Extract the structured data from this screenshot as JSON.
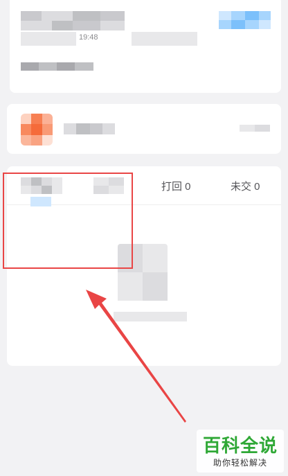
{
  "assignment_card": {
    "time_partial": "19:48"
  },
  "tabs": {
    "returned_label": "打回 0",
    "unsubmitted_label": "未交 0"
  },
  "colors": {
    "background": "#f2f2f4",
    "card": "#ffffff",
    "annotation_red": "#e94545",
    "watermark_green": "#2fa836",
    "accent_blue": "#7cc0fb"
  },
  "watermark": {
    "title": "百科全说",
    "subtitle": "助你轻松解决"
  }
}
